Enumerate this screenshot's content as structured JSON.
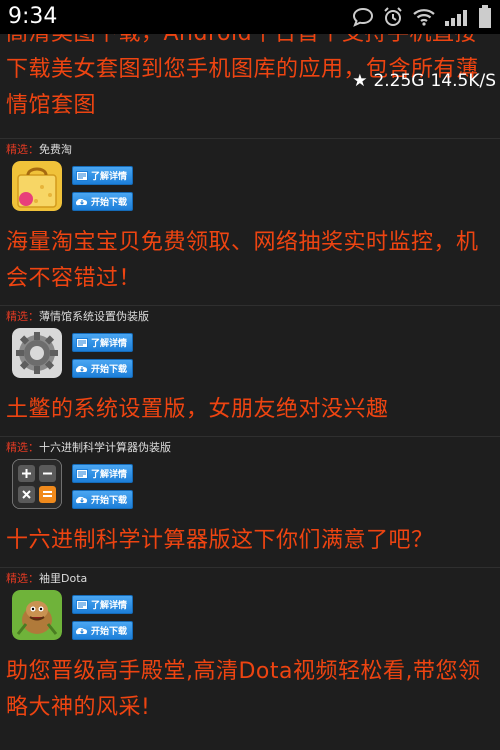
{
  "status_bar": {
    "time": "9:34",
    "network_type": "2.25G",
    "speed": "14.5K/S"
  },
  "top_text": "高清美图下载，Android平台首个支持手机直接下载美女套图到您手机图库的应用，包含所有薄情馆套图",
  "apps": [
    {
      "tag": "精选",
      "sep": "：",
      "name": "免费淘",
      "icon": "shopping-bag-icon",
      "detail_label": "了解详情",
      "download_label": "开始下载",
      "description": "海量淘宝宝贝免费领取、网络抽奖实时监控，机会不容错过！"
    },
    {
      "tag": "精选",
      "sep": "：",
      "name": "薄情馆系统设置伪装版",
      "icon": "gear-icon",
      "detail_label": "了解详情",
      "download_label": "开始下载",
      "description": "土鳖的系统设置版，女朋友绝对没兴趣"
    },
    {
      "tag": "精选",
      "sep": "：",
      "name": "十六进制科学计算器伪装版",
      "icon": "calculator-icon",
      "detail_label": "了解详情",
      "download_label": "开始下载",
      "description": "十六进制科学计算器版这下你们满意了吧？"
    },
    {
      "tag": "精选",
      "sep": "：",
      "name": "袖里Dota",
      "icon": "dota-hero-icon",
      "detail_label": "了解详情",
      "download_label": "开始下载",
      "description": "助您晋级高手殿堂,高清Dota视频轻松看,带您领略大神的风采!"
    }
  ],
  "colors": {
    "accent_orange": "#ee4411",
    "tag_red": "#e13a23",
    "button_blue": "#2b8ee6",
    "background": "#1e1e1e"
  }
}
